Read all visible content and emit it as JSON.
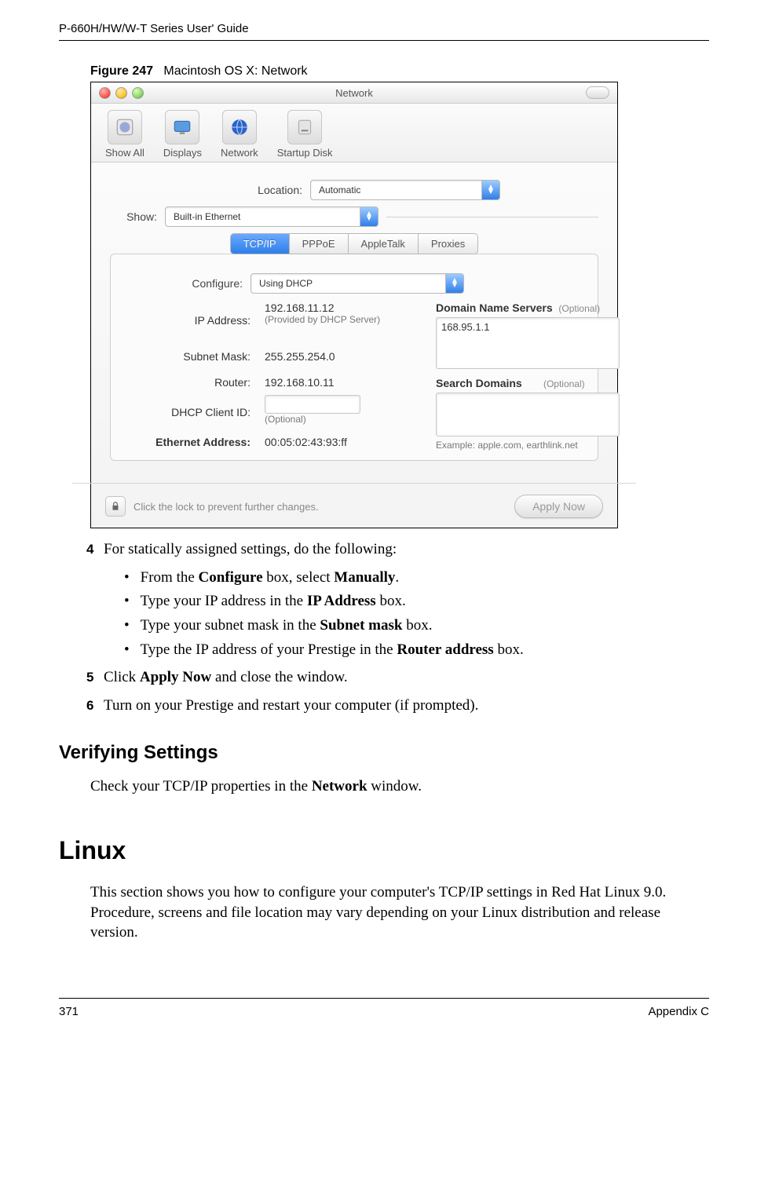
{
  "doc": {
    "header": "P-660H/HW/W-T Series User' Guide",
    "footer_left": "371",
    "footer_right": "Appendix C"
  },
  "figure": {
    "label": "Figure 247",
    "caption": "Macintosh OS X: Network"
  },
  "macwin": {
    "title": "Network",
    "toolbar": {
      "showall": "Show All",
      "displays": "Displays",
      "network": "Network",
      "startup": "Startup Disk"
    },
    "location_label": "Location:",
    "location_value": "Automatic",
    "show_label": "Show:",
    "show_value": "Built-in Ethernet",
    "tabs": {
      "tcpip": "TCP/IP",
      "pppoe": "PPPoE",
      "appletalk": "AppleTalk",
      "proxies": "Proxies"
    },
    "configure_label": "Configure:",
    "configure_value": "Using DHCP",
    "ip_label": "IP Address:",
    "ip_value": "192.168.11.12",
    "ip_sub": "(Provided by DHCP Server)",
    "subnet_label": "Subnet Mask:",
    "subnet_value": "255.255.254.0",
    "router_label": "Router:",
    "router_value": "192.168.10.11",
    "dhcp_label": "DHCP Client ID:",
    "dhcp_sub": "(Optional)",
    "eth_label": "Ethernet Address:",
    "eth_value": "00:05:02:43:93:ff",
    "dns_label": "Domain Name Servers",
    "dns_opt": "(Optional)",
    "dns_value": "168.95.1.1",
    "search_label": "Search Domains",
    "search_opt": "(Optional)",
    "search_example": "Example: apple.com, earthlink.net",
    "lock_text": "Click the lock to prevent further changes.",
    "apply_btn": "Apply Now"
  },
  "steps": {
    "s4": "For statically assigned settings, do the following:",
    "b1a": "From the ",
    "b1b": "Configure",
    "b1c": " box, select ",
    "b1d": "Manually",
    "b1e": ".",
    "b2a": "Type your IP address in the ",
    "b2b": "IP Address",
    "b2c": " box.",
    "b3a": "Type your subnet mask in the ",
    "b3b": "Subnet mask",
    "b3c": " box.",
    "b4a": "Type the IP address of your Prestige in the ",
    "b4b": "Router address",
    "b4c": " box.",
    "s5a": "Click ",
    "s5b": "Apply Now",
    "s5c": " and close the window.",
    "s6": "Turn on your Prestige and restart your computer (if prompted)."
  },
  "verify": {
    "heading": "Verifying Settings",
    "text_a": "Check your TCP/IP properties in the ",
    "text_b": "Network",
    "text_c": " window."
  },
  "linux": {
    "heading": "Linux",
    "para": "This section shows you how to configure your computer's TCP/IP settings in Red Hat Linux 9.0. Procedure, screens and file location may vary depending on your Linux distribution and release version."
  }
}
